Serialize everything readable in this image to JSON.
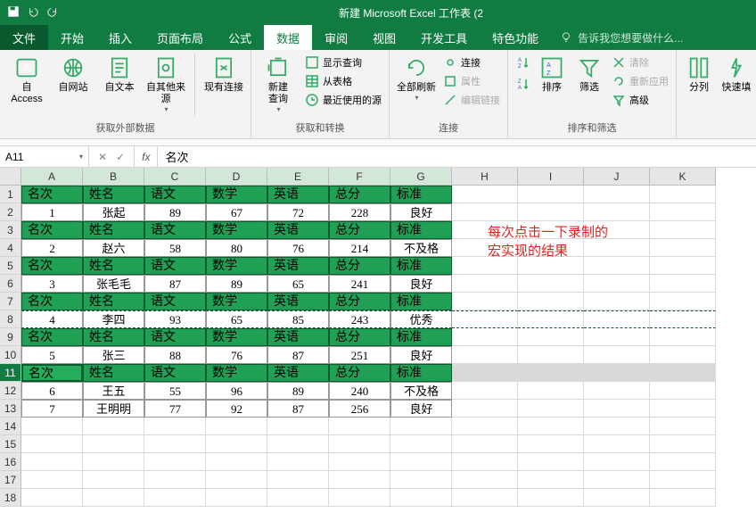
{
  "title": "新建 Microsoft Excel 工作表 (2",
  "menu": {
    "file": "文件",
    "home": "开始",
    "insert": "插入",
    "layout": "页面布局",
    "formula": "公式",
    "data": "数据",
    "review": "审阅",
    "view": "视图",
    "dev": "开发工具",
    "feature": "特色功能",
    "tell": "告诉我您想要做什么..."
  },
  "ribbon": {
    "g1": {
      "access": "自 Access",
      "web": "自网站",
      "text": "自文本",
      "other": "自其他来源",
      "conn": "现有连接",
      "label": "获取外部数据"
    },
    "g2": {
      "new": "新建\n查询",
      "show": "显示查询",
      "table": "从表格",
      "recent": "最近使用的源",
      "label": "获取和转换"
    },
    "g3": {
      "refresh": "全部刷新",
      "conn": "连接",
      "prop": "属性",
      "edit": "编辑链接",
      "label": "连接"
    },
    "g4": {
      "az": "A",
      "za": "Z",
      "sort": "排序",
      "filter": "筛选",
      "clear": "清除",
      "reapply": "重新应用",
      "adv": "高级",
      "label": "排序和筛选"
    },
    "g5": {
      "split": "分列",
      "flash": "快速填"
    }
  },
  "namebox": "A11",
  "formula": "名次",
  "cols": [
    "A",
    "B",
    "C",
    "D",
    "E",
    "F",
    "G",
    "H",
    "I",
    "J",
    "K"
  ],
  "headers": {
    "c1": "名次",
    "c2": "姓名",
    "c3": "语文",
    "c4": "数学",
    "c5": "英语",
    "c6": "总分",
    "c7": "标准"
  },
  "rows": [
    {
      "r": "1",
      "name": "张起",
      "yw": "89",
      "sx": "67",
      "yy": "72",
      "zf": "228",
      "bz": "良好"
    },
    {
      "r": "2",
      "name": "赵六",
      "yw": "58",
      "sx": "80",
      "yy": "76",
      "zf": "214",
      "bz": "不及格"
    },
    {
      "r": "3",
      "name": "张毛毛",
      "yw": "87",
      "sx": "89",
      "yy": "65",
      "zf": "241",
      "bz": "良好"
    },
    {
      "r": "4",
      "name": "李四",
      "yw": "93",
      "sx": "65",
      "yy": "85",
      "zf": "243",
      "bz": "优秀"
    },
    {
      "r": "5",
      "name": "张三",
      "yw": "88",
      "sx": "76",
      "yy": "87",
      "zf": "251",
      "bz": "良好"
    },
    {
      "r": "6",
      "name": "王五",
      "yw": "55",
      "sx": "96",
      "yy": "89",
      "zf": "240",
      "bz": "不及格"
    },
    {
      "r": "7",
      "name": "王明明",
      "yw": "77",
      "sx": "92",
      "yy": "87",
      "zf": "256",
      "bz": "良好"
    }
  ],
  "note1": "每次点击一下录制的",
  "note2": "宏实现的结果"
}
